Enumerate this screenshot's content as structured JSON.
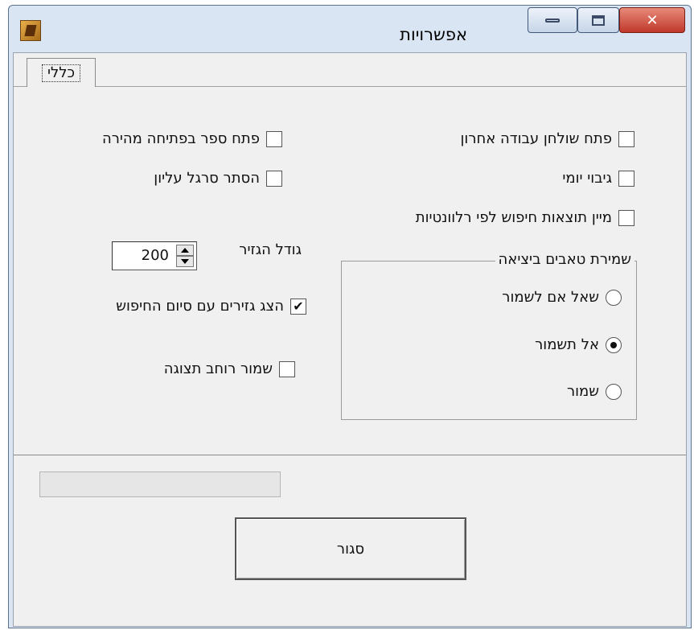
{
  "window": {
    "title": "אפשרויות",
    "app_icon": "book-icon",
    "controls": {
      "minimize": "minimize-icon",
      "maximize": "maximize-icon",
      "close": "✕"
    }
  },
  "tabs": [
    {
      "label": "כללי",
      "selected": true
    }
  ],
  "general": {
    "checkboxes": {
      "open_last_table": {
        "label": "פתח שולחן עבודה אחרון",
        "checked": false
      },
      "daily_backup": {
        "label": "גיבוי יומי",
        "checked": false
      },
      "sort_by_relevance": {
        "label": "מיין תוצאות חיפוש לפי רלוונטיות",
        "checked": false
      },
      "open_book_quick": {
        "label": "פתח ספר בפתיחה מהירה",
        "checked": false
      },
      "hide_top_bar": {
        "label": "הסתר סרגל עליון",
        "checked": false
      },
      "show_snippets": {
        "label": "הצג גזירים עם סיום החיפוש",
        "checked": true,
        "mark": "✔"
      },
      "save_view_width": {
        "label": "שמור רוחב תצוגה",
        "checked": false
      }
    },
    "snippet_size": {
      "label": "גודל הגזיר",
      "value": "200"
    },
    "save_tabs_group": {
      "legend": "שמירת טאבים ביציאה",
      "options": [
        {
          "label": "שאל אם לשמור",
          "selected": false
        },
        {
          "label": "אל תשמור",
          "selected": true
        },
        {
          "label": "שמור",
          "selected": false
        }
      ]
    }
  },
  "footer": {
    "progress": 0,
    "close_label": "סגור"
  }
}
